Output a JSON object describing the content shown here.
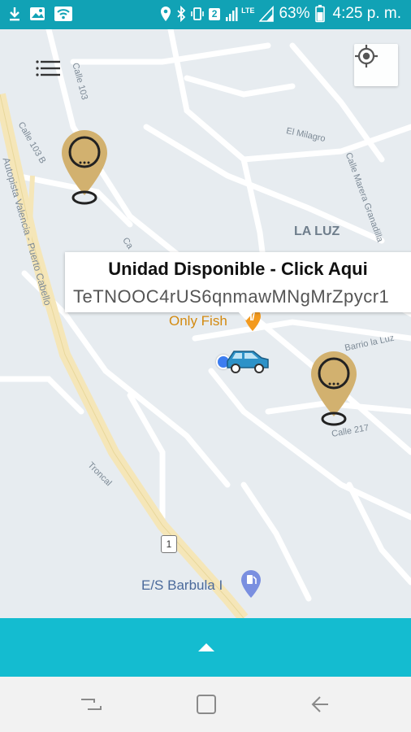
{
  "status_bar": {
    "battery_percent": "63%",
    "time": "4:25 p. m.",
    "notification_badge": "2",
    "network_label": "LTE",
    "background_color": "#11a2b5"
  },
  "map": {
    "street_labels": {
      "calle_103": "Calle 103",
      "calle_103b": "Calle 103 B",
      "autopista": "Autopista Valencia - Puerto Cabello",
      "el_milagro": "El Milagro",
      "calle_marera": "Calle Marera Granadilla",
      "la_luz": "LA LUZ",
      "barrio_la_luz": "Barrio la Luz",
      "calle_217": "Calle 217",
      "troncal": "Troncal",
      "road_shield": "1",
      "ca_partial": "Ca"
    },
    "places": {
      "only_fish": "Only Fish",
      "gas_station": "E/S Barbula I"
    },
    "icons": [
      "menu-icon",
      "my-location-icon",
      "driver-marker-icon",
      "car-icon",
      "user-location-dot",
      "food-pin-icon",
      "gas-pin-icon"
    ]
  },
  "info_window": {
    "title": "Unidad Disponible - Click Aqui",
    "id_text": "TeTNOOC4rUS6qnmawMNgMrZpycr1"
  },
  "bottom_panel": {
    "expand_icon": "chevron-up-icon",
    "color": "#14bcd0"
  },
  "nav_bar": {
    "buttons": [
      "recents-icon",
      "home-icon",
      "back-icon"
    ]
  }
}
